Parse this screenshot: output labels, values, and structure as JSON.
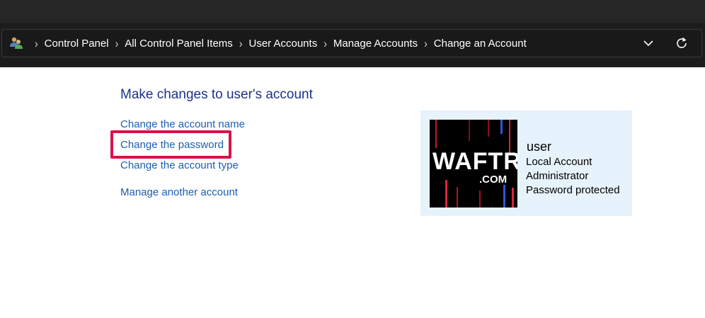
{
  "breadcrumb": {
    "icon": "users-icon",
    "items": [
      "Control Panel",
      "All Control Panel Items",
      "User Accounts",
      "Manage Accounts",
      "Change an Account"
    ]
  },
  "header": {
    "title": "Make changes to user's account"
  },
  "links": [
    "Change the account name",
    "Change the password",
    "Change the account type",
    "Manage another account"
  ],
  "account": {
    "avatar_text": "WAFTR",
    "avatar_subtext": ".COM",
    "name": "user",
    "type": "Local Account",
    "role": "Administrator",
    "status": "Password protected"
  },
  "colors": {
    "highlight": "#d6134a",
    "link": "#1a5fb4",
    "heading": "#1e3287",
    "card_bg": "#e6f3fd"
  }
}
